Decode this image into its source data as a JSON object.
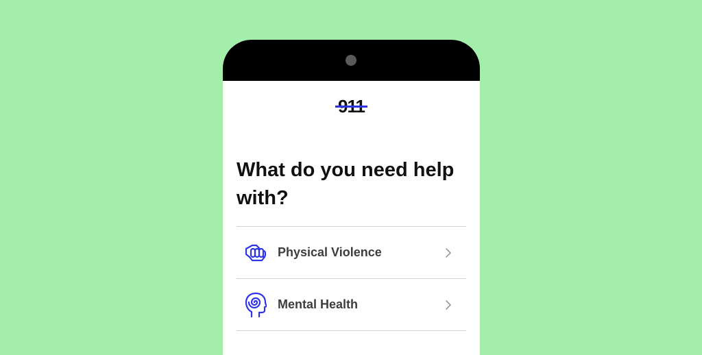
{
  "app": {
    "logo_text": "911"
  },
  "screen": {
    "headline": "What do you need help with?"
  },
  "menu": {
    "items": [
      {
        "label": "Physical Violence",
        "icon": "fist-icon"
      },
      {
        "label": "Mental Health",
        "icon": "head-spiral-icon"
      }
    ]
  },
  "colors": {
    "background": "#a4eeab",
    "accent": "#2f33e6",
    "phone_frame": "#000000"
  }
}
